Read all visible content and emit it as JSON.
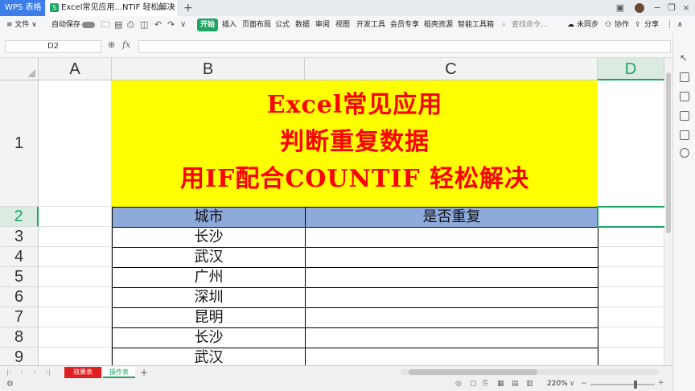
{
  "app": {
    "logo": "WPS 表格",
    "tab_title": "Excel常见应用...NTIF 轻松解决"
  },
  "menu": {
    "file": "≡ 文件 ∨",
    "autosave": "自动保存",
    "start": "开始",
    "items": [
      "插入",
      "页面布局",
      "公式",
      "数据",
      "审阅",
      "视图",
      "开发工具",
      "会员专享",
      "稻壳资源",
      "智能工具箱"
    ],
    "search": "查找命令...",
    "right": [
      "未同步",
      "协作",
      "分享"
    ]
  },
  "formula_bar": {
    "cell_ref": "D2",
    "fx": "fx",
    "value": ""
  },
  "columns": [
    "A",
    "B",
    "C",
    "D"
  ],
  "rows": [
    "1",
    "2",
    "3",
    "4",
    "5",
    "6",
    "7",
    "8",
    "9"
  ],
  "banner": {
    "line1": "Excel常见应用",
    "line2": "判断重复数据",
    "line3": "用IF配合COUNTIF 轻松解决"
  },
  "table": {
    "headers": [
      "城市",
      "是否重复"
    ],
    "cities": [
      "长沙",
      "武汉",
      "广州",
      "深圳",
      "昆明",
      "长沙",
      "武汉"
    ]
  },
  "sheets": [
    "效果表",
    "操作表"
  ],
  "status": {
    "zoom": "220%"
  },
  "colors": {
    "accent_green": "#1fa463",
    "banner_bg": "#ffff00",
    "banner_text": "#ff0000",
    "header_fill": "#8eaadc",
    "selected_col": "#1fa463"
  }
}
